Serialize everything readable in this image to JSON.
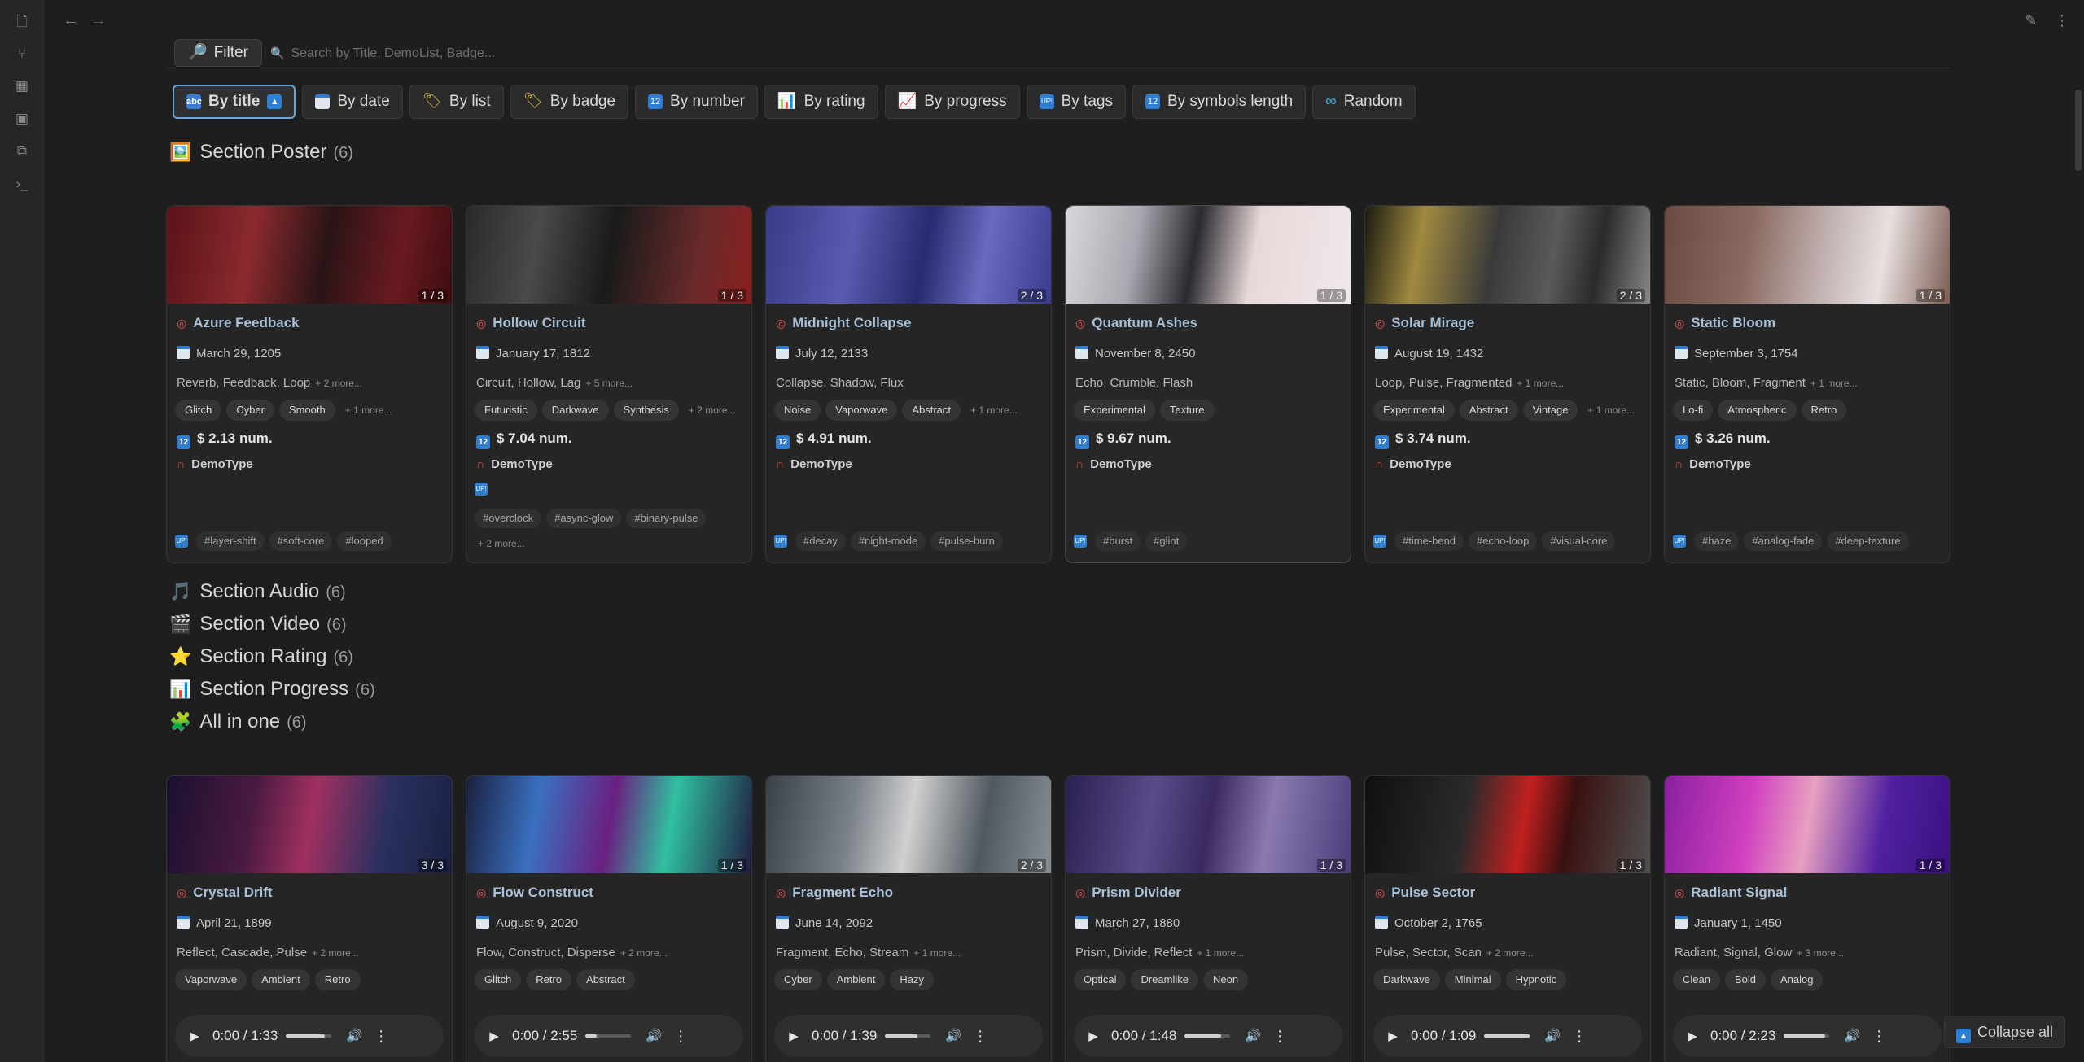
{
  "ribbon": {
    "icons": [
      "file-icon",
      "graph-icon",
      "grid-icon",
      "calendar-icon",
      "copy-icon",
      "terminal-icon"
    ]
  },
  "filter": {
    "label": "Filter",
    "icon": "magnifier-icon"
  },
  "search": {
    "placeholder": "Search by Title, DemoList, Badge..."
  },
  "sort_buttons": [
    {
      "label": "By title",
      "active": true,
      "icon": "abc-icon"
    },
    {
      "label": "By date",
      "icon": "calendar-icon"
    },
    {
      "label": "By list",
      "icon": "label-icon"
    },
    {
      "label": "By badge",
      "icon": "label-icon"
    },
    {
      "label": "By number",
      "icon": "number-icon"
    },
    {
      "label": "By rating",
      "icon": "bar-chart-icon"
    },
    {
      "label": "By progress",
      "icon": "line-chart-icon"
    },
    {
      "label": "By tags",
      "icon": "tag-icon"
    },
    {
      "label": "By symbols length",
      "icon": "number-icon"
    },
    {
      "label": "Random",
      "icon": "infinity-icon"
    }
  ],
  "sections": {
    "poster": {
      "emoji": "🖼️",
      "title": "Section Poster",
      "count": "(6)"
    },
    "audio": {
      "emoji": "🎵",
      "title": "Section Audio",
      "count": "(6)"
    },
    "video": {
      "emoji": "🎬",
      "title": "Section Video",
      "count": "(6)"
    },
    "rating": {
      "emoji": "⭐",
      "title": "Section Rating",
      "count": "(6)"
    },
    "progress": {
      "emoji": "📊",
      "title": "Section Progress",
      "count": "(6)"
    },
    "allinone": {
      "emoji": "🧩",
      "title": "All in one",
      "count": "(6)"
    }
  },
  "poster_cards": [
    {
      "title": "Azure Feedback",
      "pager": "1 / 3",
      "date": "March 29, 1205",
      "list": "Reverb, Feedback, Loop",
      "list_more": "+ 2 more...",
      "badges": [
        "Glitch",
        "Cyber",
        "Smooth"
      ],
      "badges_more": "+ 1 more...",
      "number": "$ 2.13 num.",
      "demo": "DemoType",
      "tags": [
        "#layer-shift",
        "#soft-core",
        "#looped"
      ],
      "tags_more": ""
    },
    {
      "title": "Hollow Circuit",
      "pager": "1 / 3",
      "date": "January 17, 1812",
      "list": "Circuit, Hollow, Lag",
      "list_more": "+ 5 more...",
      "badges": [
        "Futuristic",
        "Darkwave",
        "Synthesis"
      ],
      "badges_more": "+ 2 more...",
      "number": "$ 7.04 num.",
      "demo": "DemoType",
      "tags": [
        "#overclock",
        "#async-glow",
        "#binary-pulse"
      ],
      "tags_more": "+ 2 more..."
    },
    {
      "title": "Midnight Collapse",
      "pager": "2 / 3",
      "date": "July 12, 2133",
      "list": "Collapse, Shadow, Flux",
      "list_more": "",
      "badges": [
        "Noise",
        "Vaporwave",
        "Abstract"
      ],
      "badges_more": "+ 1 more...",
      "number": "$ 4.91 num.",
      "demo": "DemoType",
      "tags": [
        "#decay",
        "#night-mode",
        "#pulse-burn"
      ],
      "tags_more": ""
    },
    {
      "title": "Quantum Ashes",
      "pager": "1 / 3",
      "date": "November 8, 2450",
      "list": "Echo, Crumble, Flash",
      "list_more": "",
      "badges": [
        "Experimental",
        "Texture"
      ],
      "badges_more": "",
      "number": "$ 9.67 num.",
      "demo": "DemoType",
      "tags": [
        "#burst",
        "#glint"
      ],
      "tags_more": ""
    },
    {
      "title": "Solar Mirage",
      "pager": "2 / 3",
      "date": "August 19, 1432",
      "list": "Loop, Pulse, Fragmented",
      "list_more": "+ 1 more...",
      "badges": [
        "Experimental",
        "Abstract",
        "Vintage"
      ],
      "badges_more": "+ 1 more...",
      "number": "$ 3.74 num.",
      "demo": "DemoType",
      "tags": [
        "#time-bend",
        "#echo-loop",
        "#visual-core"
      ],
      "tags_more": ""
    },
    {
      "title": "Static Bloom",
      "pager": "1 / 3",
      "date": "September 3, 1754",
      "list": "Static, Bloom, Fragment",
      "list_more": "+ 1 more...",
      "badges": [
        "Lo-fi",
        "Atmospheric",
        "Retro"
      ],
      "badges_more": "",
      "number": "$ 3.26 num.",
      "demo": "DemoType",
      "tags": [
        "#haze",
        "#analog-fade",
        "#deep-texture"
      ],
      "tags_more": ""
    }
  ],
  "audio_cards": [
    {
      "title": "Crystal Drift",
      "pager": "3 / 3",
      "date": "April 21, 1899",
      "list": "Reflect, Cascade, Pulse",
      "list_more": "+ 2 more...",
      "badges": [
        "Vaporwave",
        "Ambient",
        "Retro"
      ],
      "time": "0:00 / 1:33",
      "volume_fraction": 0.85
    },
    {
      "title": "Flow Construct",
      "pager": "1 / 3",
      "date": "August 9, 2020",
      "list": "Flow, Construct, Disperse",
      "list_more": "+ 2 more...",
      "badges": [
        "Glitch",
        "Retro",
        "Abstract"
      ],
      "time": "0:00 / 2:55",
      "volume_fraction": 0.25
    },
    {
      "title": "Fragment Echo",
      "pager": "2 / 3",
      "date": "June 14, 2092",
      "list": "Fragment, Echo, Stream",
      "list_more": "+ 1 more...",
      "badges": [
        "Cyber",
        "Ambient",
        "Hazy"
      ],
      "time": "0:00 / 1:39",
      "volume_fraction": 0.7
    },
    {
      "title": "Prism Divider",
      "pager": "1 / 3",
      "date": "March 27, 1880",
      "list": "Prism, Divide, Reflect",
      "list_more": "+ 1 more...",
      "badges": [
        "Optical",
        "Dreamlike",
        "Neon"
      ],
      "time": "0:00 / 1:48",
      "volume_fraction": 0.8
    },
    {
      "title": "Pulse Sector",
      "pager": "1 / 3",
      "date": "October 2, 1765",
      "list": "Pulse, Sector, Scan",
      "list_more": "+ 2 more...",
      "badges": [
        "Darkwave",
        "Minimal",
        "Hypnotic"
      ],
      "time": "0:00 / 1:09",
      "volume_fraction": 1.0
    },
    {
      "title": "Radiant Signal",
      "pager": "1 / 3",
      "date": "January 1, 1450",
      "list": "Radiant, Signal, Glow",
      "list_more": "+ 3 more...",
      "badges": [
        "Clean",
        "Bold",
        "Analog"
      ],
      "time": "0:00 / 2:23",
      "volume_fraction": 0.9
    }
  ],
  "collapse_all": {
    "label": "Collapse all"
  }
}
